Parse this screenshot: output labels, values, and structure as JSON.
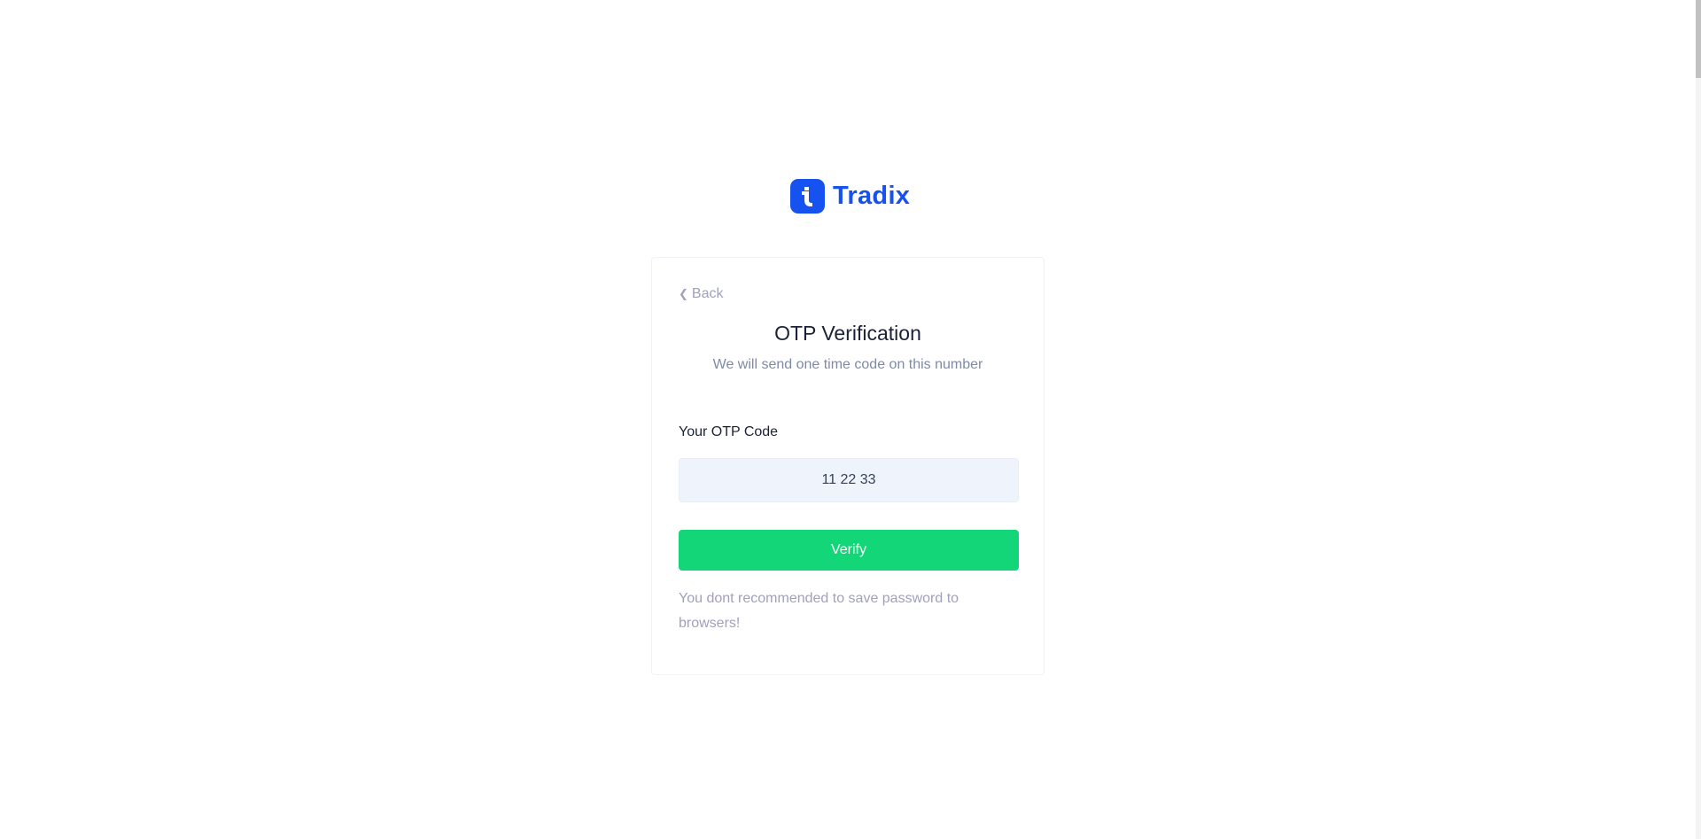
{
  "brand": {
    "name": "Tradix",
    "color": "#1652f0",
    "icon": "tradix-logo-icon"
  },
  "back": {
    "label": "Back",
    "icon": "chevron-left-icon"
  },
  "heading": {
    "title": "OTP Verification",
    "subtitle": "We will send one time code on this number"
  },
  "form": {
    "otp_label": "Your OTP Code",
    "otp_value": "11 22 33",
    "verify_label": "Verify",
    "verify_color": "#12d677"
  },
  "note": "You dont recommended to save password to browsers!"
}
